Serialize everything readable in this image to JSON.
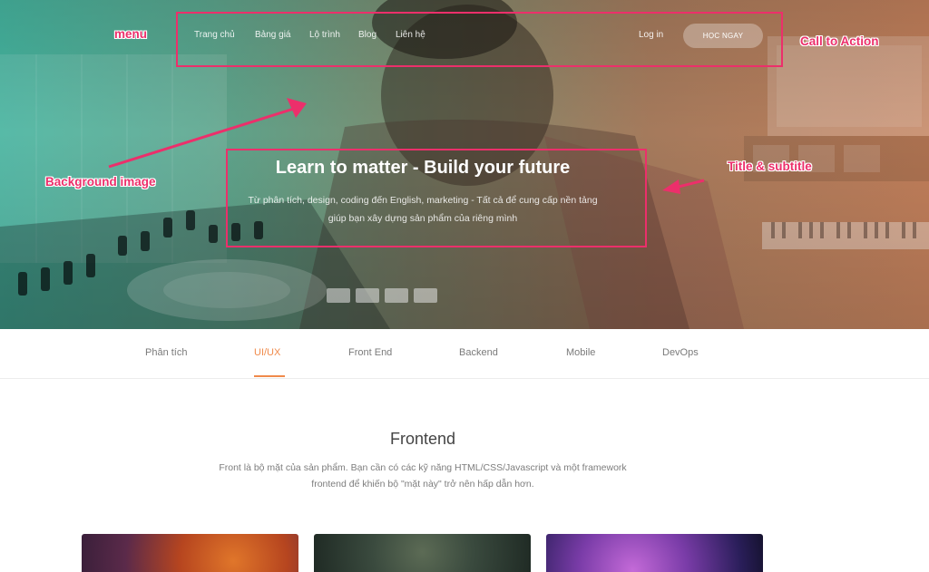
{
  "nav": {
    "items": [
      "Trang chủ",
      "Bảng giá",
      "Lộ trình",
      "Blog",
      "Liên hệ"
    ],
    "login": "Log in",
    "cta": "HỌC NGAY"
  },
  "hero": {
    "title": "Learn to matter - Build your future",
    "subtitle": "Từ phân tích, design, coding đến English, marketing - Tất cả để cung cấp nền tảng giúp bạn xây dựng sản phẩm của riêng mình"
  },
  "annotations": {
    "menu": "menu",
    "cta": "Call to Action",
    "background": "Background  image",
    "title": "Title & subtitle"
  },
  "tabs": [
    "Phân tích",
    "UI/UX",
    "Front End",
    "Backend",
    "Mobile",
    "DevOps"
  ],
  "active_tab": "UI/UX",
  "section": {
    "title": "Frontend",
    "description": "Front là bộ mặt của sản phẩm. Bạn cần có các kỹ năng HTML/CSS/Javascript và một framework frontend để khiến bộ \"mặt này\" trở nên hấp dẫn hơn."
  },
  "colors": {
    "annotation": "#ec2f6b",
    "accent": "#f08a4b",
    "hero_left": "#45b39e",
    "hero_right": "#c07e5a"
  }
}
